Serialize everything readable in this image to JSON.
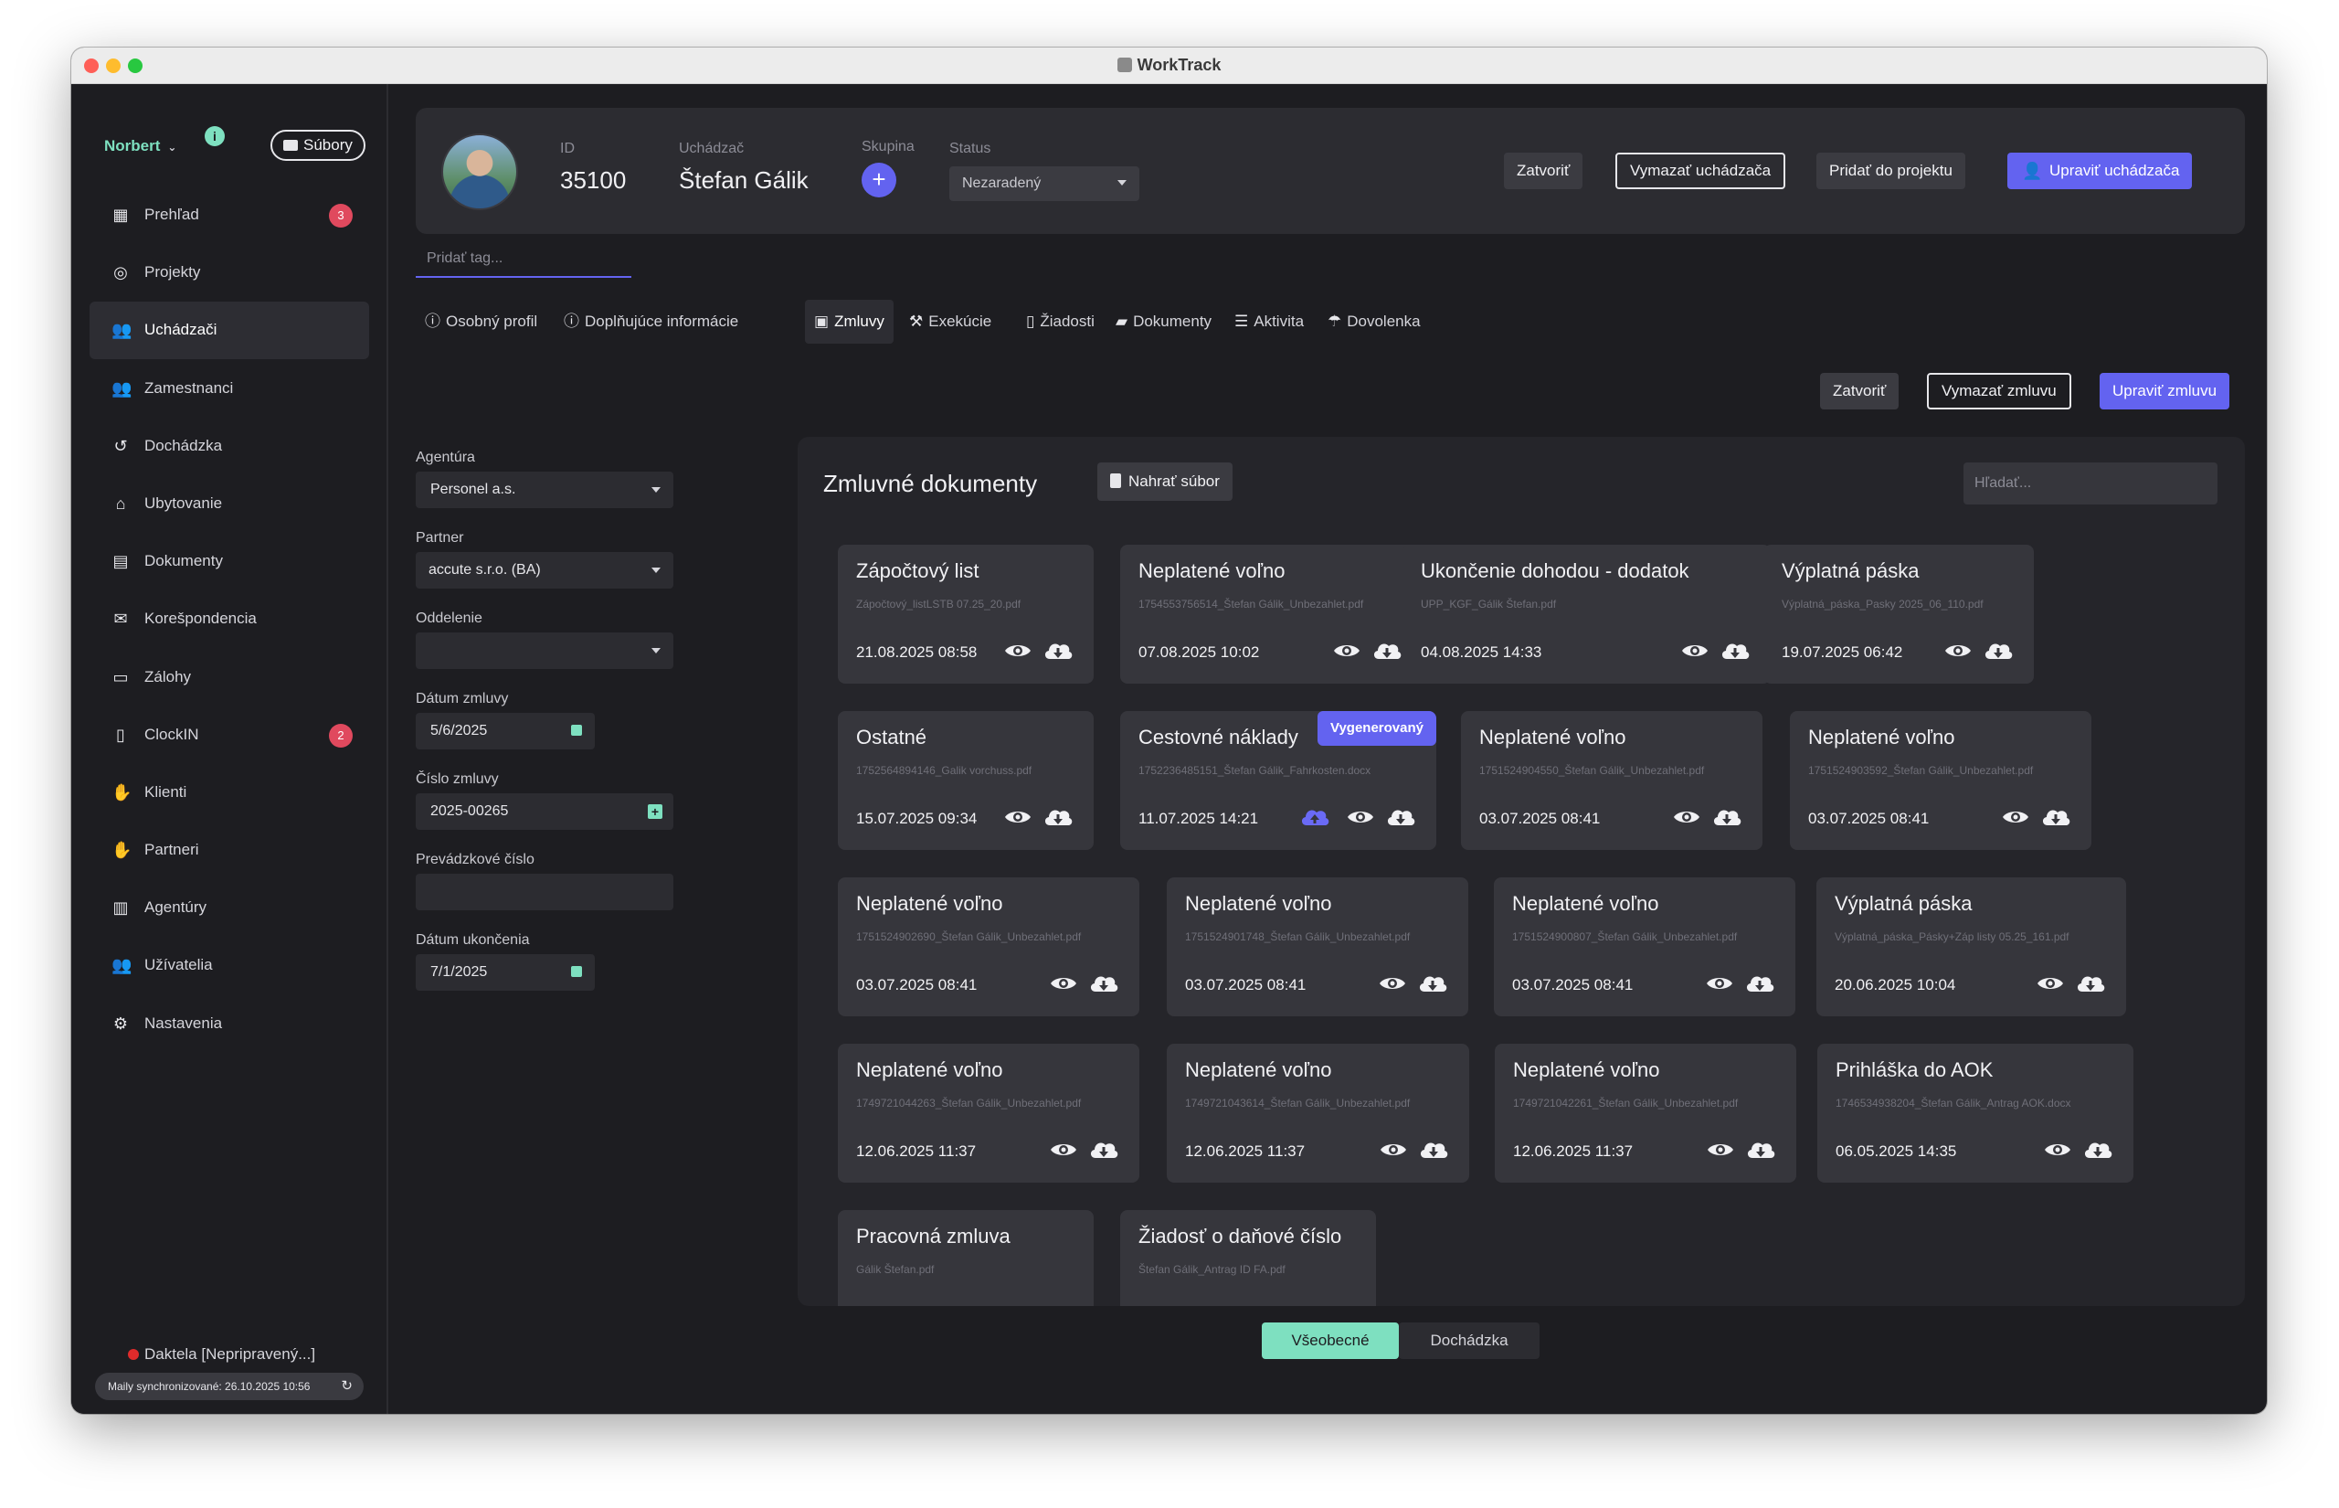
{
  "window": {
    "title": "WorkTrack"
  },
  "sidebar": {
    "user": "Norbert",
    "info": "i",
    "files_label": "Súbory",
    "items": [
      {
        "label": "Prehľad",
        "icon": "grid-icon",
        "glyph": "▦",
        "badge": "3",
        "active": false
      },
      {
        "label": "Projekty",
        "icon": "projects-icon",
        "glyph": "◎",
        "badge": "",
        "active": false
      },
      {
        "label": "Uchádzači",
        "icon": "applicants-icon",
        "glyph": "👥",
        "badge": "",
        "active": true
      },
      {
        "label": "Zamestnanci",
        "icon": "employees-icon",
        "glyph": "👥",
        "badge": "",
        "active": false
      },
      {
        "label": "Dochádzka",
        "icon": "history-icon",
        "glyph": "↺",
        "badge": "",
        "active": false
      },
      {
        "label": "Ubytovanie",
        "icon": "house-icon",
        "glyph": "⌂",
        "badge": "",
        "active": false
      },
      {
        "label": "Dokumenty",
        "icon": "documents-icon",
        "glyph": "▤",
        "badge": "",
        "active": false
      },
      {
        "label": "Korešpondencia",
        "icon": "envelope-icon",
        "glyph": "✉",
        "badge": "",
        "active": false
      },
      {
        "label": "Zálohy",
        "icon": "money-icon",
        "glyph": "▭",
        "badge": "",
        "active": false
      },
      {
        "label": "ClockIN",
        "icon": "phone-icon",
        "glyph": "▯",
        "badge": "2",
        "active": false
      },
      {
        "label": "Klienti",
        "icon": "handshake-icon",
        "glyph": "✋",
        "badge": "",
        "active": false
      },
      {
        "label": "Partneri",
        "icon": "partners-icon",
        "glyph": "✋",
        "badge": "",
        "active": false
      },
      {
        "label": "Agentúry",
        "icon": "building-icon",
        "glyph": "▥",
        "badge": "",
        "active": false
      },
      {
        "label": "Užívatelia",
        "icon": "users-icon",
        "glyph": "👥",
        "badge": "",
        "active": false
      },
      {
        "label": "Nastavenia",
        "icon": "gears-icon",
        "glyph": "⚙",
        "badge": "",
        "active": false
      }
    ],
    "daktela": "Daktela [Nepripravený...]",
    "sync": "Maily synchronizované: 26.10.2025 10:56"
  },
  "header": {
    "id_label": "ID",
    "id_value": "35100",
    "applicant_label": "Uchádzač",
    "applicant_value": "Štefan Gálik",
    "group_label": "Skupina",
    "group_add": "+",
    "status_label": "Status",
    "status_value": "Nezaradený",
    "close": "Zatvoriť",
    "delete": "Vymazať uchádzača",
    "add_project": "Pridať do projektu",
    "edit": "Upraviť uchádzača"
  },
  "tag_placeholder": "Pridať tag...",
  "tabs": [
    {
      "label": "Osobný profil",
      "icon": "info-icon",
      "glyph": "ⓘ"
    },
    {
      "label": "Doplňujúce informácie",
      "icon": "info-icon",
      "glyph": "ⓘ"
    },
    {
      "label": "Zmluvy",
      "icon": "money-icon",
      "glyph": "▣"
    },
    {
      "label": "Exekúcie",
      "icon": "gavel-icon",
      "glyph": "⚒"
    },
    {
      "label": "Žiadosti",
      "icon": "phone-icon",
      "glyph": "▯"
    },
    {
      "label": "Dokumenty",
      "icon": "folder-icon",
      "glyph": "▰"
    },
    {
      "label": "Aktivita",
      "icon": "list-icon",
      "glyph": "☰"
    },
    {
      "label": "Dovolenka",
      "icon": "umbrella-icon",
      "glyph": "☂"
    }
  ],
  "contract_actions": {
    "close": "Zatvoriť",
    "delete": "Vymazať zmluvu",
    "edit": "Upraviť zmluvu"
  },
  "form": {
    "agency_label": "Agentúra",
    "agency_value": "Personel a.s.",
    "partner_label": "Partner",
    "partner_value": "accute s.r.o. (BA)",
    "department_label": "Oddelenie",
    "department_value": "",
    "contract_date_label": "Dátum zmluvy",
    "contract_date_value": "5/6/2025",
    "contract_no_label": "Číslo zmluvy",
    "contract_no_value": "2025-00265",
    "operation_no_label": "Prevádzkové číslo",
    "operation_no_value": "",
    "end_date_label": "Dátum ukončenia",
    "end_date_value": "7/1/2025"
  },
  "docs": {
    "title": "Zmluvné dokumenty",
    "upload": "Nahrať súbor",
    "search_placeholder": "Hľadať...",
    "items": [
      {
        "title": "Zápočtový list",
        "file": "Zápočtový_listLSTB 07.25_20.pdf",
        "date": "21.08.2025 08:58"
      },
      {
        "title": "Neplatené voľno",
        "file": "1754553756514_Štefan Gálik_Unbezahlet.pdf",
        "date": "07.08.2025 10:02"
      },
      {
        "title": "Ukončenie dohodou - dodatok",
        "file": "UPP_KGF_Gálik Štefan.pdf",
        "date": "04.08.2025 14:33"
      },
      {
        "title": "Výplatná páska",
        "file": "Výplatná_páska_Pasky 2025_06_110.pdf",
        "date": "19.07.2025 06:42"
      },
      {
        "title": "Ostatné",
        "file": "1752564894146_Galik vorchuss.pdf",
        "date": "15.07.2025 09:34"
      },
      {
        "title": "Cestovné náklady",
        "file": "1752236485151_Štefan Gálik_Fahrkosten.docx",
        "date": "11.07.2025 14:21",
        "badge": "Vygenerovaný"
      },
      {
        "title": "Neplatené voľno",
        "file": "1751524904550_Štefan Gálik_Unbezahlet.pdf",
        "date": "03.07.2025 08:41"
      },
      {
        "title": "Neplatené voľno",
        "file": "1751524903592_Štefan Gálik_Unbezahlet.pdf",
        "date": "03.07.2025 08:41"
      },
      {
        "title": "Neplatené voľno",
        "file": "1751524902690_Štefan Gálik_Unbezahlet.pdf",
        "date": "03.07.2025 08:41"
      },
      {
        "title": "Neplatené voľno",
        "file": "1751524901748_Štefan Gálik_Unbezahlet.pdf",
        "date": "03.07.2025 08:41"
      },
      {
        "title": "Neplatené voľno",
        "file": "1751524900807_Štefan Gálik_Unbezahlet.pdf",
        "date": "03.07.2025 08:41"
      },
      {
        "title": "Výplatná páska",
        "file": "Výplatná_páska_Pásky+Záp listy 05.25_161.pdf",
        "date": "20.06.2025 10:04"
      },
      {
        "title": "Neplatené voľno",
        "file": "1749721044263_Štefan Gálik_Unbezahlet.pdf",
        "date": "12.06.2025 11:37"
      },
      {
        "title": "Neplatené voľno",
        "file": "1749721043614_Štefan Gálik_Unbezahlet.pdf",
        "date": "12.06.2025 11:37"
      },
      {
        "title": "Neplatené voľno",
        "file": "1749721042261_Štefan Gálik_Unbezahlet.pdf",
        "date": "12.06.2025 11:37"
      },
      {
        "title": "Prihláška do AOK",
        "file": "1746534938204_Štefan Gálik_Antrag AOK.docx",
        "date": "06.05.2025 14:35"
      },
      {
        "title": "Pracovná zmluva",
        "file": "Gálik Štefan.pdf",
        "date": ""
      },
      {
        "title": "Žiadosť o daňové číslo",
        "file": "Štefan Gálik_Antrag ID FA.pdf",
        "date": ""
      }
    ]
  },
  "bottom_tabs": {
    "general": "Všeobecné",
    "attendance": "Dochádzka"
  }
}
